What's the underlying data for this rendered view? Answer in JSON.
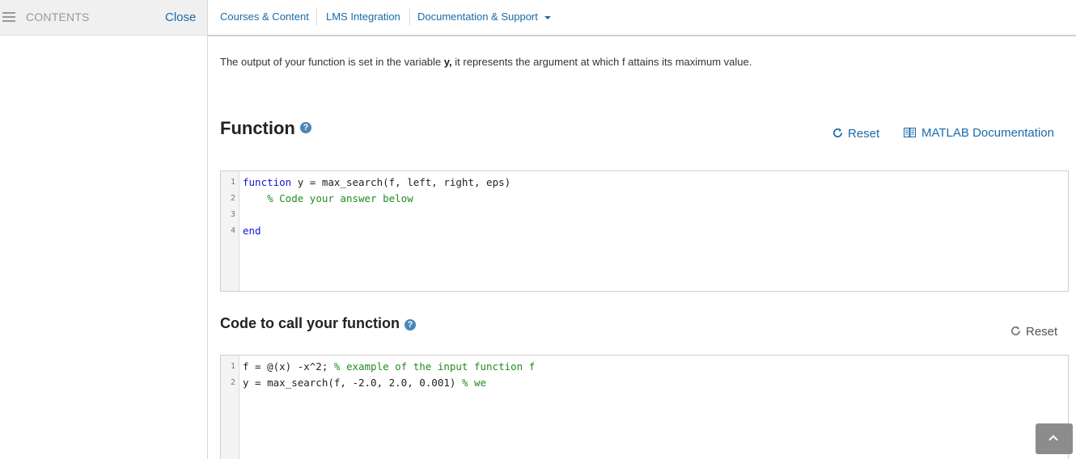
{
  "sidebar": {
    "contents_label": "CONTENTS",
    "close_label": "Close"
  },
  "nav": {
    "items": [
      {
        "label": "Courses & Content"
      },
      {
        "label": "LMS Integration"
      },
      {
        "label": "Documentation & Support"
      }
    ]
  },
  "intro": {
    "before": "The output of your function is set in the variable ",
    "var": "y,",
    "after": " it represents the argument at which f attains its maximum value."
  },
  "function_section": {
    "title": "Function",
    "reset_label": "Reset",
    "doc_label": "MATLAB Documentation",
    "lines": [
      {
        "num": "1",
        "kw": "function",
        "text": " y = max_search(f, left, right, eps)",
        "comment": ""
      },
      {
        "num": "2",
        "kw": "",
        "text": "    ",
        "comment": "% Code your answer below"
      },
      {
        "num": "3",
        "kw": "",
        "text": "",
        "comment": ""
      },
      {
        "num": "4",
        "kw": "end",
        "text": "",
        "comment": ""
      }
    ]
  },
  "call_section": {
    "title": "Code to call your function",
    "reset_label": "Reset",
    "lines": [
      {
        "num": "1",
        "kw": "",
        "text": "f = @(x) -x^2; ",
        "comment": "% example of the input function f"
      },
      {
        "num": "2",
        "kw": "",
        "text": "y = max_search(f, -2.0, 2.0, 0.001) ",
        "comment": "% we"
      }
    ]
  },
  "colors": {
    "link": "#1a6aa8",
    "help": "#4a86b8",
    "keyword": "#1414d6",
    "comment": "#228b22"
  }
}
